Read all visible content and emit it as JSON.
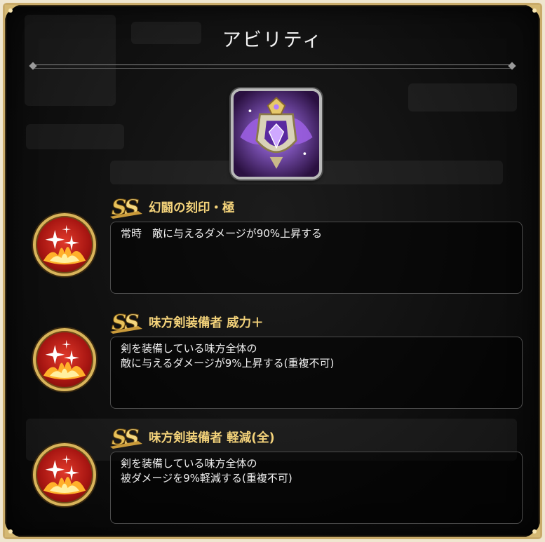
{
  "dialog": {
    "title": "アビリティ"
  },
  "weapon": {
    "icon": "winged-crest-weapon-icon"
  },
  "abilities": [
    {
      "rank_badge_icon": "ss-rank-icon",
      "icon": "sparkle-burst-icon",
      "name": "幻闘の刻印・極",
      "description": "常時　敵に与えるダメージが90%上昇する"
    },
    {
      "rank_badge_icon": "ss-rank-icon",
      "icon": "sparkle-burst-icon",
      "name": "味方剣装備者 威力＋",
      "description": "剣を装備している味方全体の\n敵に与えるダメージが9%上昇する(重複不可)"
    },
    {
      "rank_badge_icon": "ss-rank-icon",
      "icon": "sparkle-burst-icon",
      "name": "味方剣装備者 軽減(全)",
      "description": "剣を装備している味方全体の\n被ダメージを9%軽減する(重複不可)"
    }
  ],
  "colors": {
    "frame": "#c9ab6a",
    "name_gold": "#f3d27a",
    "icon_red": "#c21e18"
  }
}
